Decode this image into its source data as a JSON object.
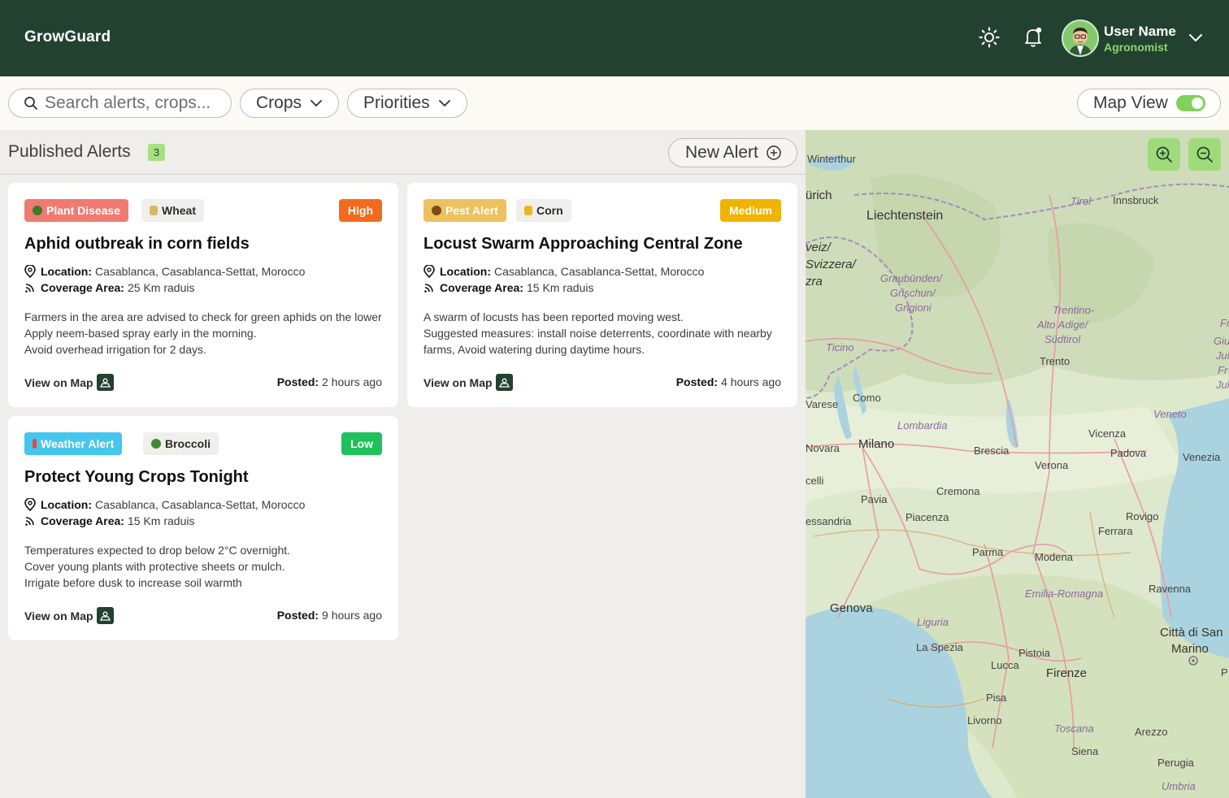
{
  "header": {
    "brand": "GrowGuard",
    "user_name": "User Name",
    "user_role": "Agronomist",
    "icons": [
      "sun-icon",
      "bell-icon",
      "chevron-down-icon"
    ]
  },
  "toolbar": {
    "search_placeholder": "Search alerts, crops...",
    "crops_label": "Crops",
    "priorities_label": "Priorities",
    "map_view_label": "Map View",
    "map_view_on": true
  },
  "alerts_panel": {
    "title": "Published Alerts",
    "count": "3",
    "new_alert_label": "New Alert",
    "cards": [
      {
        "category": "Plant Disease",
        "category_color": "#f07a72",
        "crop": "Wheat",
        "priority": "High",
        "priority_color": "#f36a1d",
        "title": "Aphid outbreak in corn fields",
        "location_label": "Location:",
        "location": "Casablanca, Casablanca-Settat, Morocco",
        "coverage_label": "Coverage Area:",
        "coverage": "25 Km raduis",
        "description": "Farmers in the area are advised to check for green aphids on the lower  Apply neem-based spray early in the morning.\nAvoid overhead irrigation for 2 days.",
        "view_map": "View on Map",
        "posted_label": "Posted:",
        "posted": "2 hours ago"
      },
      {
        "category": "Pest Alert",
        "category_color": "#eec15f",
        "crop": "Corn",
        "priority": "Medium",
        "priority_color": "#f0b400",
        "title": "Locust Swarm Approaching Central Zone",
        "location_label": "Location:",
        "location": "Casablanca, Casablanca-Settat, Morocco",
        "coverage_label": "Coverage Area:",
        "coverage": "15 Km raduis",
        "description": "A swarm of locusts has been reported moving west.\n Suggested measures: install noise deterrents, coordinate with nearby farms, Avoid watering during daytime hours.",
        "view_map": "View on Map",
        "posted_label": "Posted:",
        "posted": "4 hours ago"
      },
      {
        "category": "Weather Alert",
        "category_color": "#45c6ec",
        "crop": "Broccoli",
        "priority": "Low",
        "priority_color": "#1ec15a",
        "title": "Protect Young Crops Tonight",
        "location_label": "Location:",
        "location": "Casablanca, Casablanca-Settat, Morocco",
        "coverage_label": "Coverage Area:",
        "coverage": "15 Km raduis",
        "description": "Temperatures expected to drop below 2°C overnight.\n Cover young plants with protective sheets or mulch.\n Irrigate before dusk to increase soil warmth",
        "view_map": "View on Map",
        "posted_label": "Posted:",
        "posted": "9 hours ago"
      }
    ]
  },
  "map": {
    "labels": {
      "winterthur": "Winterthur",
      "zurich": "ürich",
      "liechtenstein": "Liechtenstein",
      "tirol": "Tirol",
      "innsbruck": "Innsbruck",
      "veiz": "veiz/",
      "svizzera": "Svizzera/",
      "zra": "zra",
      "graubunden": "Graubünden/",
      "grischun": "Grischun/",
      "grigioni": "Grigioni",
      "trentino": "Trentino-",
      "altoadige": "Alto Adige/",
      "sudtirol": "Südtirol",
      "ticino": "Ticino",
      "trento": "Trento",
      "fr": "Fr",
      "giul": "Giul",
      "juli": "Juli",
      "fr2": "Fr",
      "juli2": "Juli",
      "varese": "Varese",
      "como": "Como",
      "lombardia": "Lombardia",
      "veneto": "Veneto",
      "vicenza": "Vicenza",
      "novara": "Novara",
      "milano": "Milano",
      "brescia": "Brescia",
      "padova": "Padova",
      "venezia": "Venezia",
      "verona": "Verona",
      "celli": "celli",
      "cremona": "Cremona",
      "pavia": "Pavia",
      "essandria": "essandria",
      "piacenza": "Piacenza",
      "rovigo": "Rovigo",
      "ferrara": "Ferrara",
      "parma": "Parma",
      "modena": "Modena",
      "ravenna": "Ravenna",
      "emilia": "Emilia-Romagna",
      "genova": "Genova",
      "liguria": "Liguria",
      "cittadisan": "Città di San",
      "marino": "Marino",
      "laspezia": "La Spezia",
      "pistoia": "Pistoia",
      "lucca": "Lucca",
      "firenze": "Firenze",
      "p": "P",
      "pisa": "Pisa",
      "livorno": "Livorno",
      "toscana": "Toscana",
      "arezzo": "Arezzo",
      "siena": "Siena",
      "perugia": "Perugia",
      "umbria": "Umbria"
    },
    "zoom_in_icon": "zoom-in-icon",
    "zoom_out_icon": "zoom-out-icon"
  },
  "colors": {
    "header_bg": "#234130",
    "accent_green": "#8fd36f",
    "toggle_on": "#7fd15a"
  }
}
